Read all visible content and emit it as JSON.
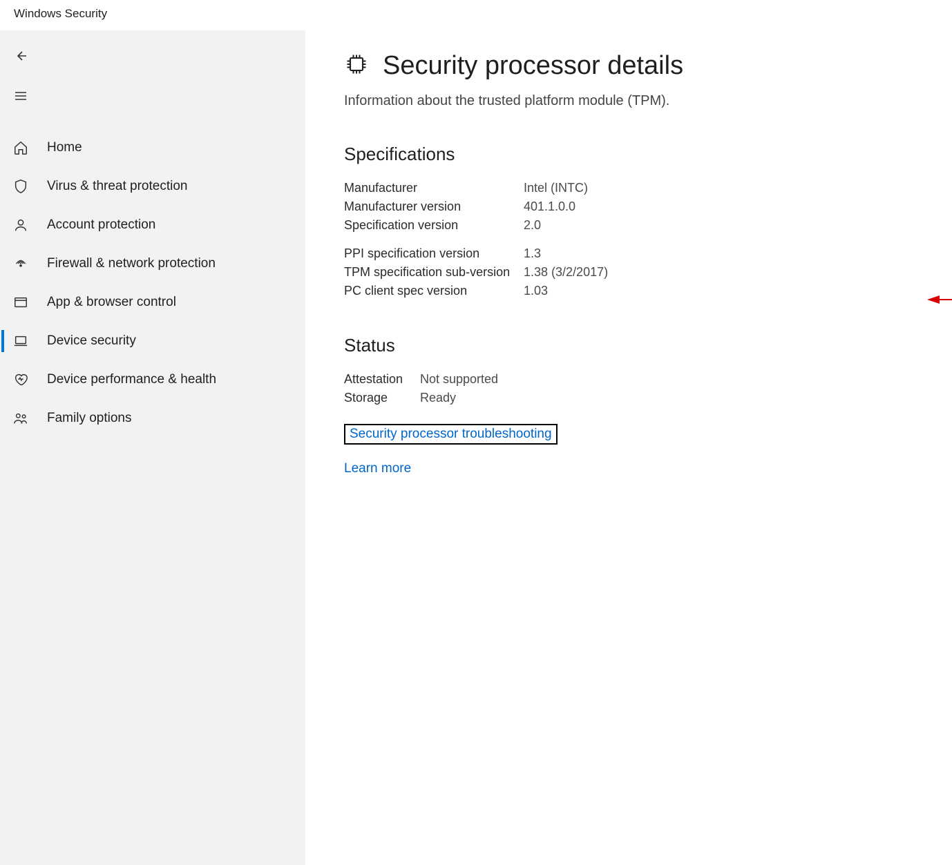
{
  "window": {
    "title": "Windows Security"
  },
  "sidebar": {
    "items": [
      {
        "label": "Home",
        "icon": "home-icon"
      },
      {
        "label": "Virus & threat protection",
        "icon": "shield-icon"
      },
      {
        "label": "Account protection",
        "icon": "person-icon"
      },
      {
        "label": "Firewall & network protection",
        "icon": "network-icon"
      },
      {
        "label": "App & browser control",
        "icon": "browser-icon"
      },
      {
        "label": "Device security",
        "icon": "device-icon",
        "selected": true
      },
      {
        "label": "Device performance & health",
        "icon": "heart-icon"
      },
      {
        "label": "Family options",
        "icon": "family-icon"
      }
    ]
  },
  "page": {
    "title": "Security processor details",
    "subtitle": "Information about the trusted platform module (TPM)."
  },
  "specifications": {
    "heading": "Specifications",
    "group1": [
      {
        "label": "Manufacturer",
        "value": "Intel (INTC)"
      },
      {
        "label": "Manufacturer version",
        "value": "401.1.0.0"
      },
      {
        "label": "Specification version",
        "value": "2.0"
      }
    ],
    "group2": [
      {
        "label": "PPI specification version",
        "value": "1.3"
      },
      {
        "label": "TPM specification sub-version",
        "value": "1.38 (3/2/2017)"
      },
      {
        "label": "PC client spec version",
        "value": "1.03"
      }
    ]
  },
  "status": {
    "heading": "Status",
    "rows": [
      {
        "label": "Attestation",
        "value": "Not supported"
      },
      {
        "label": "Storage",
        "value": "Ready"
      }
    ],
    "troubleshoot_link": "Security processor troubleshooting",
    "learn_more_link": "Learn more"
  }
}
